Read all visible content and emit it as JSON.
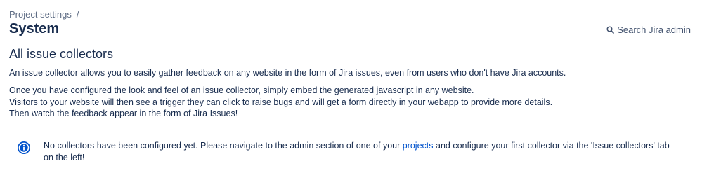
{
  "breadcrumb": {
    "project_settings": "Project settings",
    "separator": "/"
  },
  "header": {
    "title": "System",
    "search_admin_label": "Search Jira admin"
  },
  "main": {
    "heading": "All issue collectors",
    "intro": "An issue collector allows you to easily gather feedback on any website in the form of Jira issues, even from users who don't have Jira accounts.",
    "details": [
      "Once you have configured the look and feel of an issue collector, simply embed the generated javascript in any website.",
      "Visitors to your website will then see a trigger they can click to raise bugs and will get a form directly in your webapp to provide more details.",
      "Then watch the feedback appear in the form of Jira Issues!"
    ]
  },
  "info_message": {
    "icon": "info-icon",
    "text_before": "No collectors have been configured yet. Please navigate to the admin section of one of your ",
    "link_label": "projects",
    "text_after": " and configure your first collector via the 'Issue collectors' tab on the left!"
  },
  "colors": {
    "text": "#172b4d",
    "muted": "#5e6c84",
    "link": "#0052cc",
    "info_icon": "#0052cc"
  }
}
